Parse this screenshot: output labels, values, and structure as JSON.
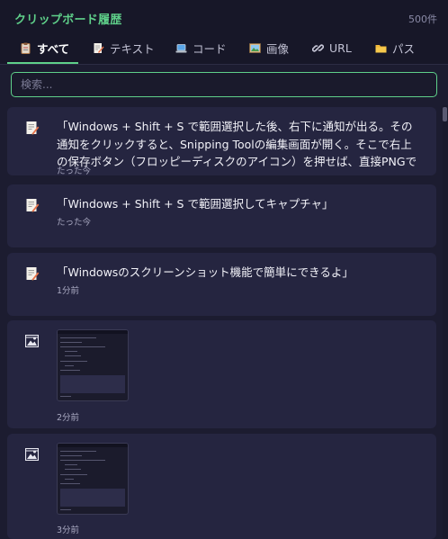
{
  "app": {
    "title": "クリップボード履歴",
    "count": "500件"
  },
  "tabs": [
    {
      "label": "すべて",
      "icon": "clipboard-icon"
    },
    {
      "label": "テキスト",
      "icon": "memo-icon"
    },
    {
      "label": "コード",
      "icon": "laptop-icon"
    },
    {
      "label": "画像",
      "icon": "picture-icon"
    },
    {
      "label": "URL",
      "icon": "link-icon"
    },
    {
      "label": "パス",
      "icon": "folder-icon"
    }
  ],
  "active_tab": "すべて",
  "search": {
    "placeholder": "検索..."
  },
  "items": [
    {
      "type": "text",
      "icon": "memo-icon",
      "text": "「Windows + Shift + S で範囲選択した後、右下に通知が出る。その通知をクリックすると、Snipping Toolの編集画面が開く。そこで右上の保存ボタン（フロッピーディスクのアイコン）を押せば、直接PNGで保存できる。ペイン",
      "time": "たった今"
    },
    {
      "type": "text",
      "icon": "memo-icon",
      "text": "「Windows + Shift + S で範囲選択してキャプチャ」",
      "time": "たった今"
    },
    {
      "type": "text",
      "icon": "memo-icon",
      "text": "「Windowsのスクリーンショット機能で簡単にできるよ」",
      "time": "1分前"
    },
    {
      "type": "image",
      "icon": "image-icon",
      "time": "2分前"
    },
    {
      "type": "image",
      "icon": "image-icon",
      "time": "3分前"
    }
  ],
  "colors": {
    "accent": "#5fd08a",
    "background": "#1c1c30",
    "card": "#252540",
    "header": "#171728"
  }
}
